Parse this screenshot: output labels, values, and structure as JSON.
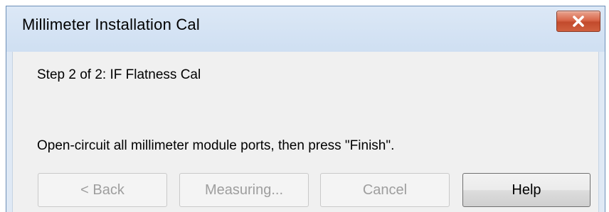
{
  "window": {
    "title": "Millimeter Installation Cal"
  },
  "content": {
    "step_label": "Step 2 of 2: IF Flatness Cal",
    "instruction": "Open-circuit all millimeter module ports, then press \"Finish\"."
  },
  "buttons": {
    "back": "< Back",
    "measuring": "Measuring...",
    "cancel": "Cancel",
    "help": "Help"
  },
  "icons": {
    "close": "close-icon"
  },
  "colors": {
    "titlebar": "#cfdff2",
    "close_button": "#d9674a",
    "client_bg": "#f0f0f0"
  }
}
